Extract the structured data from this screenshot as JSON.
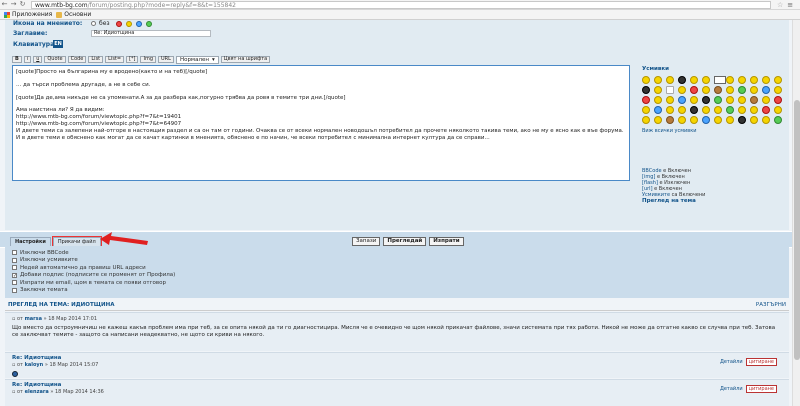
{
  "browser": {
    "url_host": "www.mtb-bg.com",
    "url_path": "/forum/posting.php?mode=reply&f=8&t=155842",
    "bookmarks": [
      "Приложения",
      "Основни"
    ]
  },
  "form": {
    "icon_label": "Икона на мнението:",
    "icon_options_text": "без",
    "subject_label": "Заглавие:",
    "subject_value": "Re: Идиотщина",
    "keyboard_label": "Клавиатура:",
    "keyboard_value": "EN"
  },
  "toolbar": {
    "buttons": [
      "B",
      "i",
      "u",
      "Quote",
      "Code",
      "List",
      "List=",
      "[*]",
      "Img",
      "URL"
    ],
    "size_select": "Нормален",
    "color_button": "Цвят на шрифта"
  },
  "editor": {
    "lines": [
      "[quote]Просто на българина му е вродено(както и на теб)[/quote]",
      "",
      "... да търси проблема другаде, а не в себе си.",
      "",
      "[quote]Да де,ама никъде не са упоменати.А за да разбера как,погурно трябва да ровя в темите три дни.[/quote]",
      "",
      "Ама наистина ли? Я да видим:",
      "http://www.mtb-bg.com/forum/viewtopic.php?f=7&t=19401",
      "http://www.mtb-bg.com/forum/viewtopic.php?f=7&t=64907",
      "И двете теми са залепени най-отгоре в настоящия раздел и са он там от години. Очаква се от всеки нормален новодошъл потребител да прочете няколкото такива теми, ако не му е ясно как е въе форума.",
      "И в двете теми е обяснено как могат да се качат картинки в мненията, обяснено е по начин, че всеки потребител с минимална интернет култура да се справи..."
    ]
  },
  "smilies": {
    "title": "Усмивки",
    "view_all": "Виж всички усмивки"
  },
  "bbinfo": [
    {
      "k": "BBCode",
      "v": "е Включен"
    },
    {
      "k": "[img]",
      "v": "е Включен"
    },
    {
      "k": "[flash]",
      "v": "е Изключен"
    },
    {
      "k": "[url]",
      "v": "е Включен"
    },
    {
      "k": "Усмивките",
      "v": "са Включени"
    }
  ],
  "preview_topic_link": "Преглед на тема",
  "buttons": {
    "save": "Запази",
    "preview": "Прегледай",
    "submit": "Изпрати"
  },
  "tabs": [
    "Настройки",
    "Прикачи файл"
  ],
  "options": [
    {
      "label": "Изключи BBCode",
      "checked": false
    },
    {
      "label": "Изключи усмивките",
      "checked": false
    },
    {
      "label": "Недей автоматично да правиш URL адреси",
      "checked": false
    },
    {
      "label": "Добави подпис (подписите се променят от Профила)",
      "checked": true
    },
    {
      "label": "Изпрати ми email, щом в темата се появи отговор",
      "checked": false
    },
    {
      "label": "Заключи темата",
      "checked": false
    }
  ],
  "review": {
    "title": "ПРЕГЛЕД НА ТЕМА: ИДИОТЩИНА",
    "expand": "РАЗГЪРНИ",
    "posts": [
      {
        "meta_prefix": "от",
        "author": "",
        "date": "» 18 Мар 2014 17:01",
        "body": "Що вместо да остроумничиш не кажеш какъв проблем има при теб, за се опита някой да ти го диагностицира. Мисля че е очевидно че щом някой прикачат файлове, значи системата при тях работи. Никой не може да отгатне какво се случва при теб. Затова се заключват темите - защото са написани неадекватно, не щото си криви на някого."
      },
      {
        "title": "Re: Идиотщина",
        "meta_prefix": "от",
        "author": "kaloyn",
        "date": "» 18 Мар 2014 15:07",
        "details": "Детайли",
        "quote": "цитиране"
      },
      {
        "title": "Re: Идиотщина",
        "meta_prefix": "от",
        "author": "elenzara",
        "date": "» 18 Мар 2014 14:36",
        "details": "Детайли",
        "quote": "цитиране"
      }
    ],
    "first_actions": {
      "details": "Детайли",
      "quote": "цитиране"
    }
  }
}
